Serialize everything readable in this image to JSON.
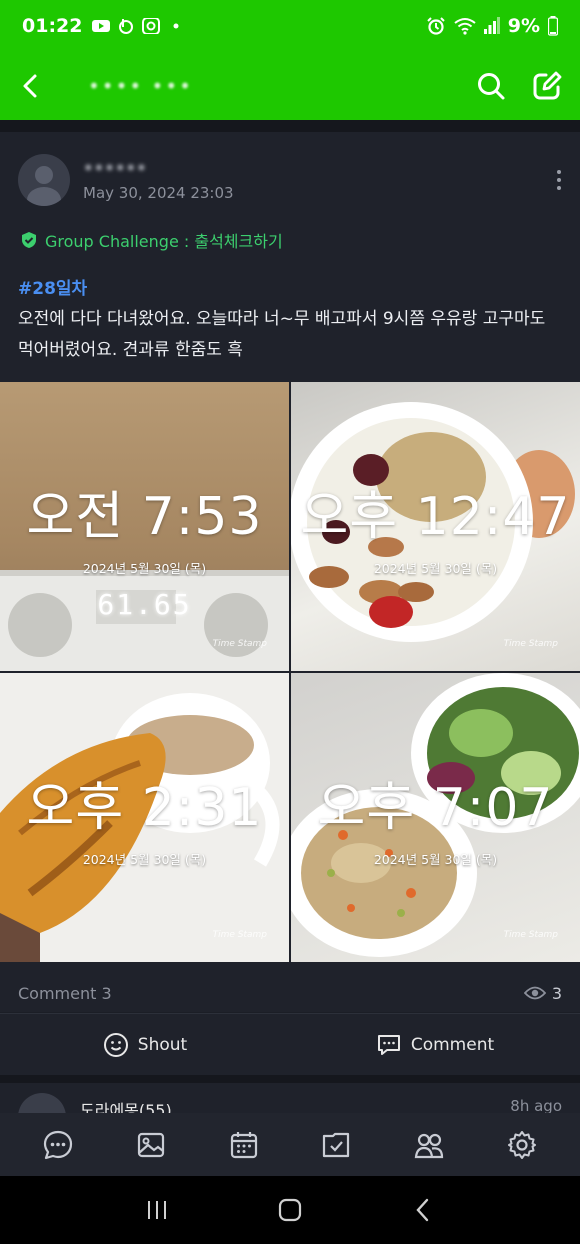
{
  "status_bar": {
    "time": "01:22",
    "battery": "9%"
  },
  "app_bar": {
    "title": "•••• •••"
  },
  "post": {
    "author_name": "••••••",
    "date": "May 30, 2024 23:03",
    "challenge_label": "Group Challenge : 출석체크하기",
    "hashtag": "#28일차",
    "body": "오전에 다다 다녀왔어요. 오늘따라 너~무 배고파서 9시쯤 우유랑 고구마도 먹어버렸어요. 견과류 한줌도 흑",
    "photos": [
      {
        "time": "오전 7:53",
        "date": "2024년 5월 30일 (목)",
        "stamp": "Time Stamp",
        "scale_reading": "61.65"
      },
      {
        "time": "오후 12:47",
        "date": "2024년 5월 30일 (목)",
        "stamp": "Time Stamp"
      },
      {
        "time": "오후 2:31",
        "date": "2024년 5월 30일 (목)",
        "stamp": "Time Stamp"
      },
      {
        "time": "오후 7:07",
        "date": "2024년 5월 30일 (목)",
        "stamp": "Time Stamp"
      }
    ],
    "comment_count_label": "Comment 3",
    "view_count": "3"
  },
  "actions": {
    "shout_label": "Shout",
    "comment_label": "Comment"
  },
  "first_comment": {
    "author": "도라에몽(55)",
    "time": "8h ago"
  },
  "colors": {
    "brand_green": "#1ec800",
    "background": "#1f222b",
    "hashtag_blue": "#4a8ff2",
    "challenge_green": "#3ccf6e"
  },
  "bottom_nav": [
    "chat-icon",
    "photo-icon",
    "calendar-icon",
    "board-icon",
    "members-icon",
    "settings-icon"
  ]
}
